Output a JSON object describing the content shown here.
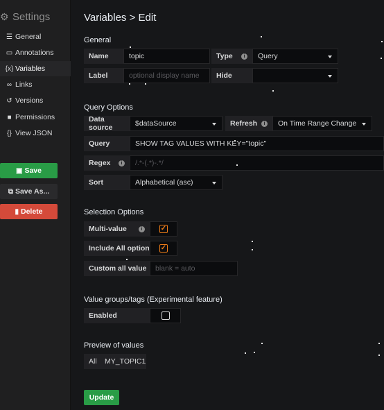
{
  "sidebar": {
    "title": "Settings",
    "items": [
      {
        "label": "General",
        "icon": "sliders-icon"
      },
      {
        "label": "Annotations",
        "icon": "comment-icon"
      },
      {
        "label": "Variables",
        "icon": "variable-icon"
      },
      {
        "label": "Links",
        "icon": "link-icon"
      },
      {
        "label": "Versions",
        "icon": "history-icon"
      },
      {
        "label": "Permissions",
        "icon": "lock-icon"
      },
      {
        "label": "View JSON",
        "icon": "code-icon"
      }
    ],
    "save_label": "Save",
    "save_as_label": "Save As...",
    "delete_label": "Delete"
  },
  "header": {
    "title": "Variables > Edit"
  },
  "general": {
    "heading": "General",
    "name_label": "Name",
    "name_value": "topic",
    "type_label": "Type",
    "type_value": "Query",
    "label_label": "Label",
    "label_placeholder": "optional display name",
    "hide_label": "Hide",
    "hide_value": ""
  },
  "query_options": {
    "heading": "Query Options",
    "datasource_label": "Data source",
    "datasource_value": "$dataSource",
    "refresh_label": "Refresh",
    "refresh_value": "On Time Range Change",
    "query_label": "Query",
    "query_value": "SHOW TAG VALUES WITH KEY=\"topic\"",
    "regex_label": "Regex",
    "regex_placeholder": "/.*-(.*)-.*/",
    "sort_label": "Sort",
    "sort_value": "Alphabetical (asc)"
  },
  "selection_options": {
    "heading": "Selection Options",
    "multi_label": "Multi-value",
    "multi_checked": true,
    "include_all_label": "Include All option",
    "include_all_checked": true,
    "custom_all_label": "Custom all value",
    "custom_all_placeholder": "blank = auto"
  },
  "value_groups": {
    "heading": "Value groups/tags (Experimental feature)",
    "enabled_label": "Enabled",
    "enabled_checked": false
  },
  "preview": {
    "heading": "Preview of values",
    "values": [
      "All",
      "MY_TOPIC1"
    ]
  },
  "update_label": "Update",
  "colors": {
    "accent_green": "#299c46",
    "danger_red": "#d44a3a",
    "checkbox_orange": "#eb7b18"
  }
}
